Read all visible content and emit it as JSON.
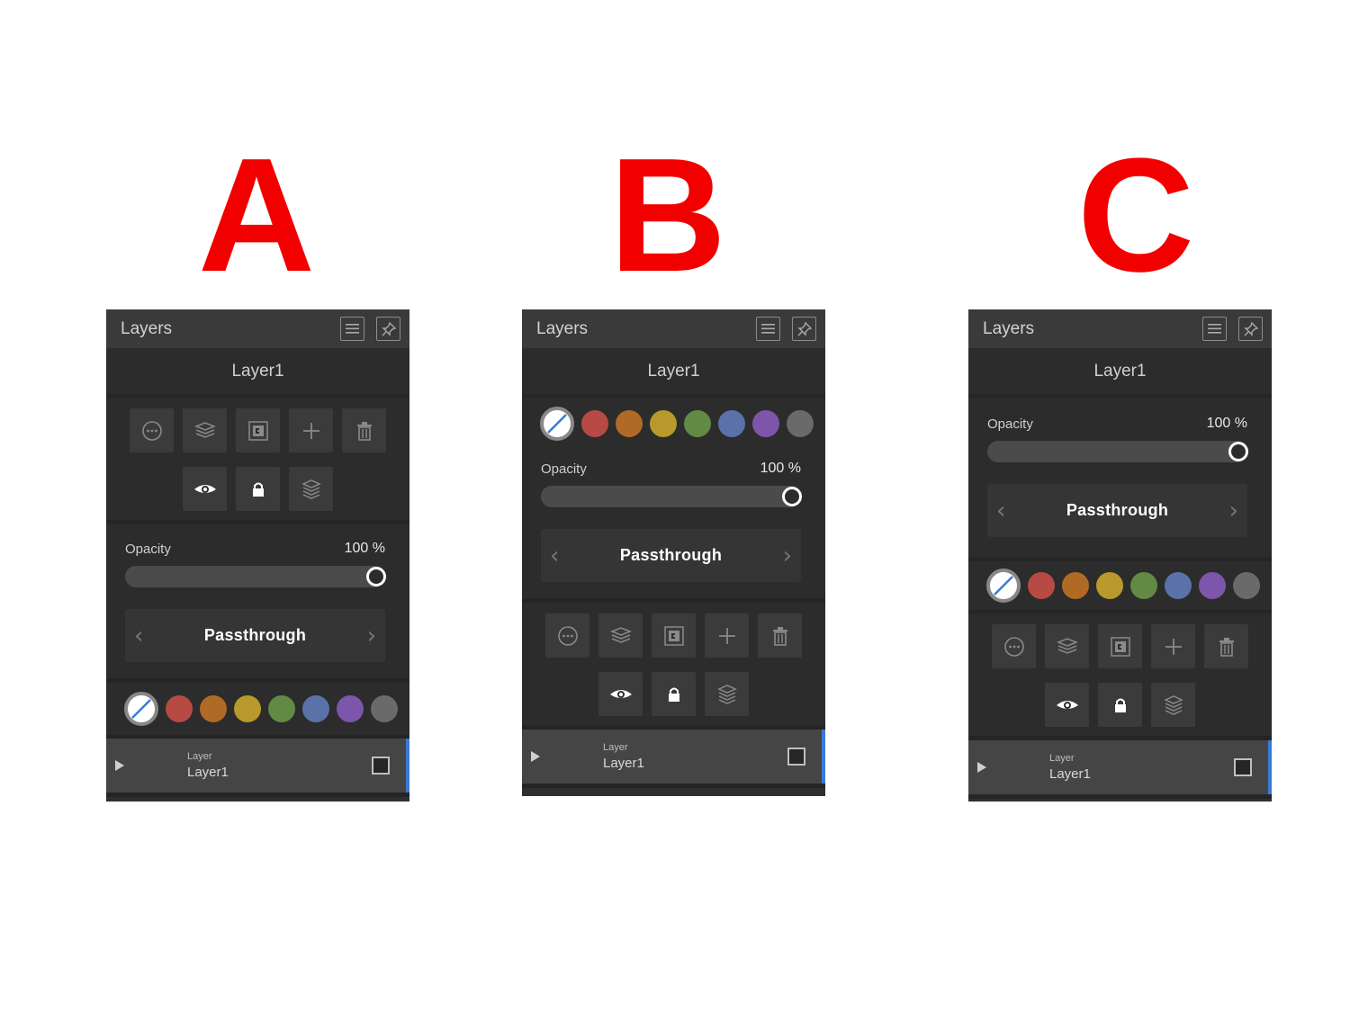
{
  "variants": [
    {
      "letter": "A",
      "header": {
        "title": "Layers",
        "menu_icon": "menu-icon",
        "pin_icon": "pin-icon"
      },
      "layer_title": "Layer1",
      "opacity": {
        "label": "Opacity",
        "value_text": "100 %",
        "value": 1.0
      },
      "blend_mode": "Passthrough",
      "tool_icons_row1": [
        "more-icon",
        "layers-stack-icon",
        "clip-mask-icon",
        "plus-icon",
        "trash-icon"
      ],
      "tool_icons_row2": [
        "eye-icon",
        "lock-icon",
        "merge-layers-icon"
      ],
      "layer_item": {
        "kind": "Layer",
        "name": "Layer1"
      }
    },
    {
      "letter": "B",
      "header": {
        "title": "Layers",
        "menu_icon": "menu-icon",
        "pin_icon": "pin-icon"
      },
      "layer_title": "Layer1",
      "opacity": {
        "label": "Opacity",
        "value_text": "100 %",
        "value": 1.0
      },
      "blend_mode": "Passthrough",
      "tool_icons_row1": [
        "more-icon",
        "layers-stack-icon",
        "clip-mask-icon",
        "plus-icon",
        "trash-icon"
      ],
      "tool_icons_row2": [
        "eye-icon",
        "lock-icon",
        "merge-layers-icon"
      ],
      "layer_item": {
        "kind": "Layer",
        "name": "Layer1"
      }
    },
    {
      "letter": "C",
      "header": {
        "title": "Layers",
        "menu_icon": "menu-icon",
        "pin_icon": "pin-icon"
      },
      "layer_title": "Layer1",
      "opacity": {
        "label": "Opacity",
        "value_text": "100 %",
        "value": 1.0
      },
      "blend_mode": "Passthrough",
      "tool_icons_row1": [
        "more-icon",
        "layers-stack-icon",
        "clip-mask-icon",
        "plus-icon",
        "trash-icon"
      ],
      "tool_icons_row2": [
        "eye-icon",
        "lock-icon",
        "merge-layers-icon"
      ],
      "layer_item": {
        "kind": "Layer",
        "name": "Layer1"
      }
    }
  ],
  "colors": {
    "letter": "#f20000",
    "swatches": [
      "#b84a44",
      "#b06a26",
      "#b89a2c",
      "#628a45",
      "#5a72a8",
      "#7d56ab",
      "#6a6a6a"
    ],
    "selection_accent": "#3a7bd5"
  }
}
